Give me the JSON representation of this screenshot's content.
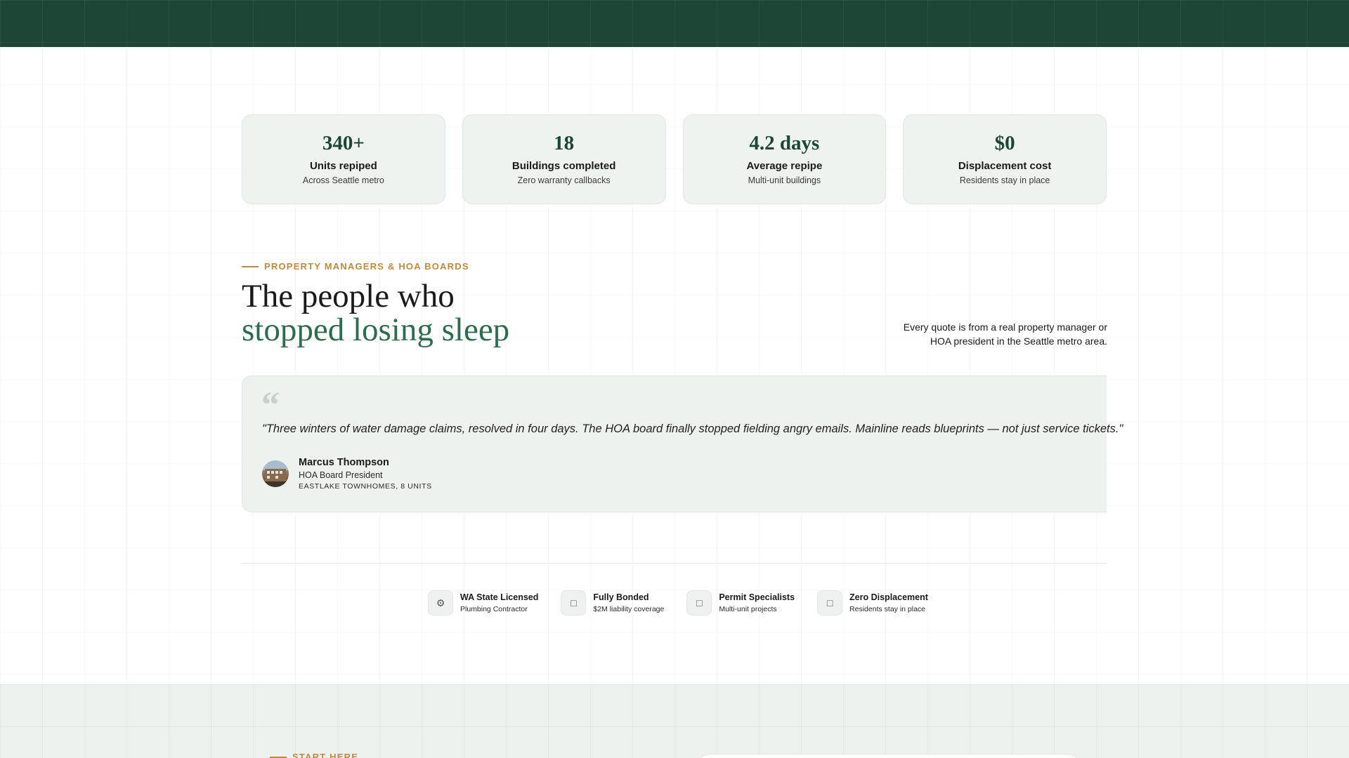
{
  "stats": [
    {
      "value": "340+",
      "label": "Units repiped",
      "sub": "Across Seattle metro"
    },
    {
      "value": "18",
      "label": "Buildings completed",
      "sub": "Zero warranty callbacks"
    },
    {
      "value": "4.2 days",
      "label": "Average repipe",
      "sub": "Multi-unit buildings"
    },
    {
      "value": "$0",
      "label": "Displacement cost",
      "sub": "Residents stay in place"
    }
  ],
  "testimonials": {
    "eyebrow": "PROPERTY MANAGERS & HOA BOARDS",
    "headline_line1": "The people who",
    "headline_line2": "stopped losing sleep",
    "intro": "Every quote is from a real property manager or HOA president in the Seattle metro area.",
    "quote_mark": "“",
    "quote": "\"Three winters of water damage claims, resolved in four days. The HOA board finally stopped fielding angry emails. Mainline reads blueprints — not just service tickets.\"",
    "author": {
      "name": "Marcus Thompson",
      "role": "HOA Board President",
      "org": "EASTLAKE TOWNHOMES, 8 UNITS"
    }
  },
  "badges": [
    {
      "icon": "gear-icon",
      "glyph": "⚙",
      "title": "WA State Licensed",
      "sub": "Plumbing Contractor"
    },
    {
      "icon": "shield-icon",
      "glyph": "□",
      "title": "Fully Bonded",
      "sub": "$2M liability coverage"
    },
    {
      "icon": "document-icon",
      "glyph": "□",
      "title": "Permit Specialists",
      "sub": "Multi-unit projects"
    },
    {
      "icon": "home-icon",
      "glyph": "□",
      "title": "Zero Displacement",
      "sub": "Residents stay in place"
    }
  ],
  "cta": {
    "eyebrow": "START HERE"
  },
  "colors": {
    "brand_green": "#1e4636",
    "accent_green": "#2f6b4f",
    "accent_gold": "#c08a3e"
  }
}
